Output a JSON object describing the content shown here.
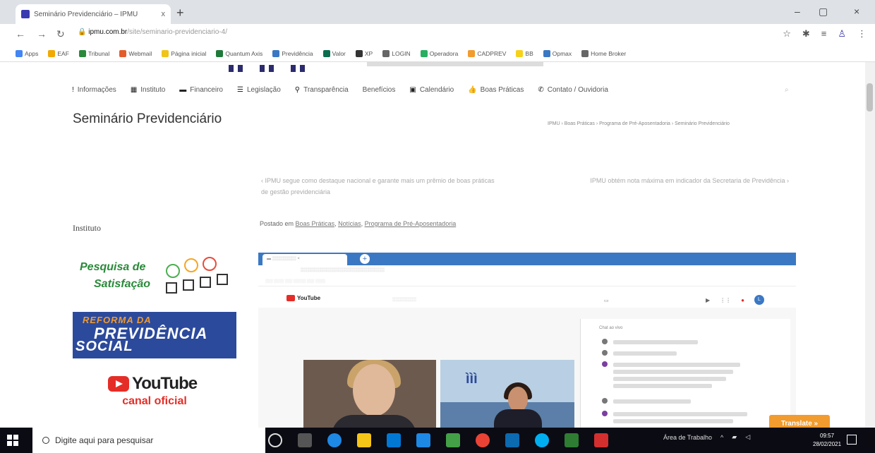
{
  "browser": {
    "tab_title": "Seminário Previdenciário – IPMU",
    "tab_close": "x",
    "new_tab": "+",
    "url_host": "ipmu.com.br",
    "url_path": "/site/seminario-previdenciario-4/",
    "window_buttons": [
      "–",
      "▢",
      "×"
    ]
  },
  "bookmarks": [
    {
      "label": "Apps",
      "color": "#4285f4"
    },
    {
      "label": "EAF",
      "color": "#f2a900"
    },
    {
      "label": "Tribunal",
      "color": "#2a8a3a"
    },
    {
      "label": "Webmail",
      "color": "#e35d2b"
    },
    {
      "label": "Página inicial",
      "color": "#f0c419"
    },
    {
      "label": "Quantum Axis",
      "color": "#1f7a3a"
    },
    {
      "label": "Previdência",
      "color": "#3b78c4"
    },
    {
      "label": "Valor",
      "color": "#0b6e4f"
    },
    {
      "label": "XP",
      "color": "#333333"
    },
    {
      "label": "LOGIN",
      "color": "#666666"
    },
    {
      "label": "Operadora",
      "color": "#27ae60"
    },
    {
      "label": "CADPREV",
      "color": "#f29b2e"
    },
    {
      "label": "BB",
      "color": "#f7d117"
    },
    {
      "label": "Opmax",
      "color": "#3b78c4"
    },
    {
      "label": "Home Broker",
      "color": "#666666"
    }
  ],
  "nav": {
    "items": [
      {
        "icon": "!",
        "label": "Informações"
      },
      {
        "icon": "▦",
        "label": "Instituto"
      },
      {
        "icon": "▬",
        "label": "Financeiro"
      },
      {
        "icon": "☰",
        "label": "Legislação"
      },
      {
        "icon": "⚲",
        "label": "Transparência"
      },
      {
        "icon": "",
        "label": "Benefícios"
      },
      {
        "icon": "▣",
        "label": "Calendário"
      },
      {
        "icon": "👍",
        "label": "Boas Práticas"
      },
      {
        "icon": "✆",
        "label": "Contato / Ouvidoria"
      }
    ]
  },
  "page": {
    "title": "Seminário Previdenciário",
    "breadcrumb": "IPMU › Boas Práticas › Programa de Pré-Aposentadoria › Seminário Previdenciário",
    "prev_post": "‹ IPMU segue como destaque nacional e garante mais um prêmio de boas práticas de gestão previdenciária",
    "next_post": "IPMU obtém nota máxima em indicador da Secretaria de Previdência ›",
    "posted_prefix": "Postado em",
    "posted_categories": [
      "Boas Práticas",
      "Notícias",
      "Programa de Pré-Aposentadoria"
    ]
  },
  "sidebar": {
    "title": "Instituto",
    "banner_pesquisa": {
      "line1": "Pesquisa de",
      "line2": "Satisfação"
    },
    "banner_reforma": {
      "line1": "REFORMA DA",
      "line2": "PREVIDÊNCIA",
      "line3": "SOCIAL"
    },
    "banner_youtube": {
      "logo": "YouTube",
      "sub": "canal oficial"
    }
  },
  "embed": {
    "yt_logo": "YouTube",
    "chat_header": "Chat ao vivo",
    "avatar": "L"
  },
  "translate_label": "Translate »",
  "taskbar": {
    "search_placeholder": "Digite aqui para pesquisar",
    "tray_label": "Área de Trabalho",
    "time": "09:57",
    "date": "28/02/2021"
  }
}
